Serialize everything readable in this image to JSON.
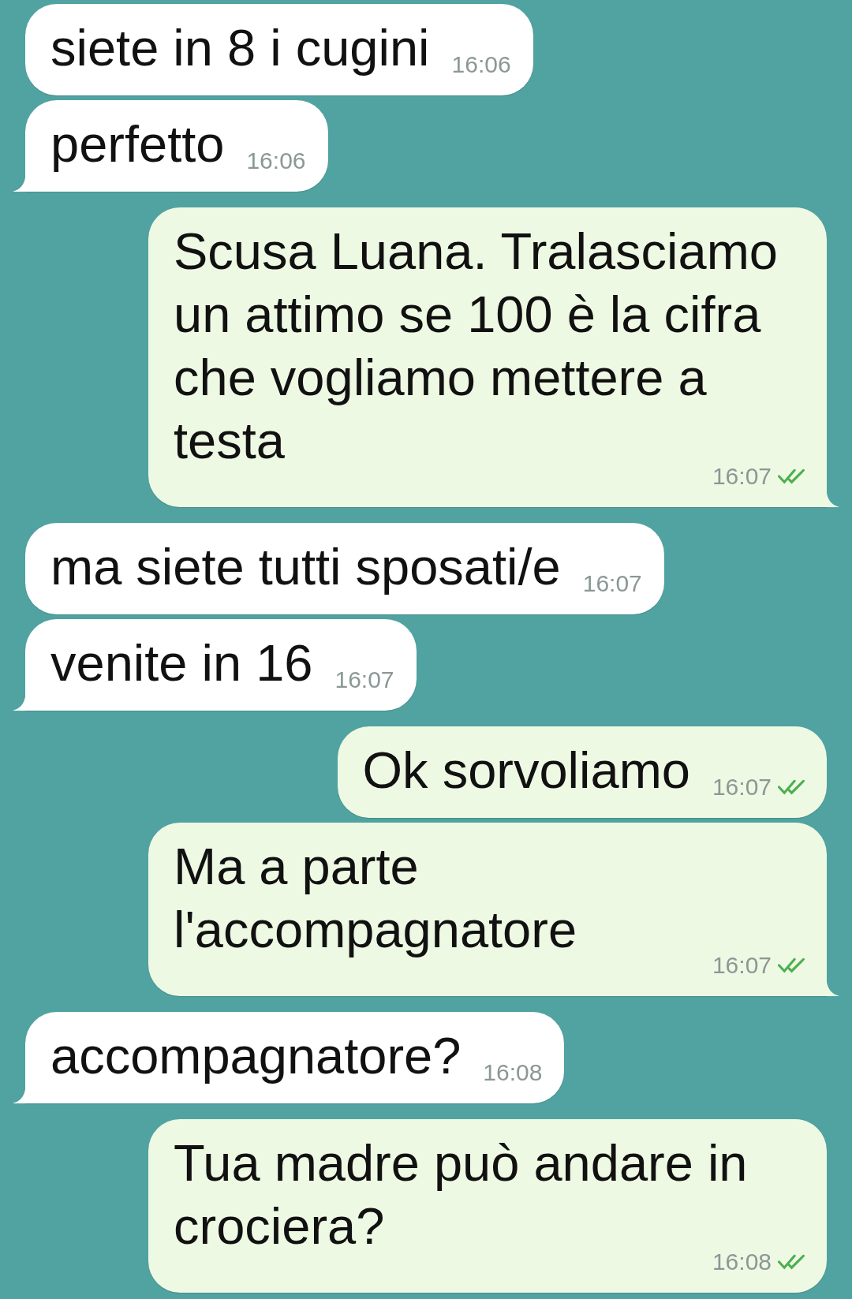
{
  "messages": [
    {
      "outgoing": false,
      "text": "siete in 8 i cugini",
      "time": "16:06",
      "tail": false
    },
    {
      "outgoing": false,
      "text": "perfetto",
      "time": "16:06",
      "tail": true
    },
    {
      "outgoing": true,
      "text": "Scusa Luana. Tralasciamo un attimo se 100 è la cifra che vogliamo mettere a testa",
      "time": "16:07",
      "read": true,
      "tail": true
    },
    {
      "outgoing": false,
      "text": "ma siete tutti sposati/e",
      "time": "16:07",
      "tail": false
    },
    {
      "outgoing": false,
      "text": "venite in 16",
      "time": "16:07",
      "tail": true
    },
    {
      "outgoing": true,
      "text": "Ok sorvoliamo",
      "time": "16:07",
      "read": true,
      "tail": false
    },
    {
      "outgoing": true,
      "text": "Ma a parte l'accompagnatore",
      "time": "16:07",
      "read": true,
      "tail": true
    },
    {
      "outgoing": false,
      "text": "accompagnatore?",
      "time": "16:08",
      "tail": true
    },
    {
      "outgoing": true,
      "text": "Tua madre può andare in crociera?",
      "time": "16:08",
      "read": true,
      "tail": false
    }
  ]
}
